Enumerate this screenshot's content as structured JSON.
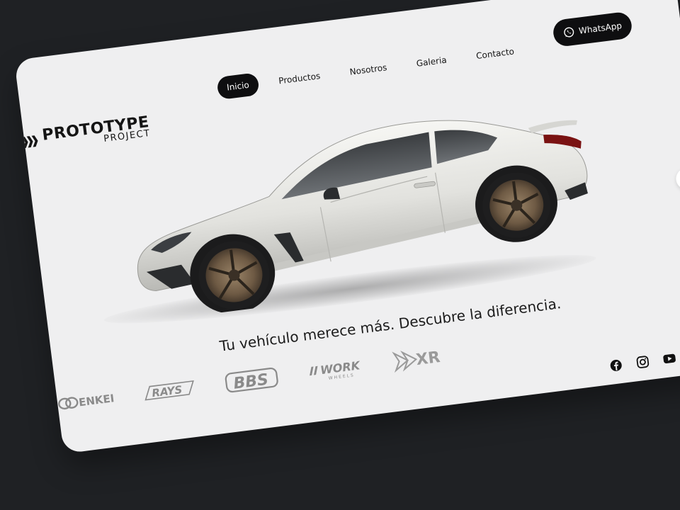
{
  "brand": {
    "title": "PROTOTYPE",
    "subtitle": "PROJECT"
  },
  "nav": {
    "items": [
      {
        "label": "Inicio",
        "active": true
      },
      {
        "label": "Productos",
        "active": false
      },
      {
        "label": "Nosotros",
        "active": false
      },
      {
        "label": "Galeria",
        "active": false
      },
      {
        "label": "Contacto",
        "active": false
      }
    ]
  },
  "whatsapp": {
    "label": "WhatsApp",
    "icon": "whatsapp-icon"
  },
  "carousel": {
    "next_icon": "chevron-right-icon",
    "next_glyph": "›"
  },
  "hero": {
    "tagline": "Tu vehículo merece más. Descubre la diferencia.",
    "car_color": "#e4e4e0",
    "wheel_color": "#7a6650"
  },
  "socials": [
    {
      "icon": "facebook-icon"
    },
    {
      "icon": "instagram-icon"
    },
    {
      "icon": "youtube-icon"
    }
  ],
  "brand_logos": [
    {
      "name": "ENKEI"
    },
    {
      "name": "RAYS"
    },
    {
      "name": "BBS"
    },
    {
      "name": "WORK",
      "sub": "WHEELS"
    },
    {
      "name": "XR"
    }
  ],
  "colors": {
    "page_bg": "#1f2124",
    "card_bg": "#efeff0",
    "accent_dark": "#0e0e10"
  }
}
